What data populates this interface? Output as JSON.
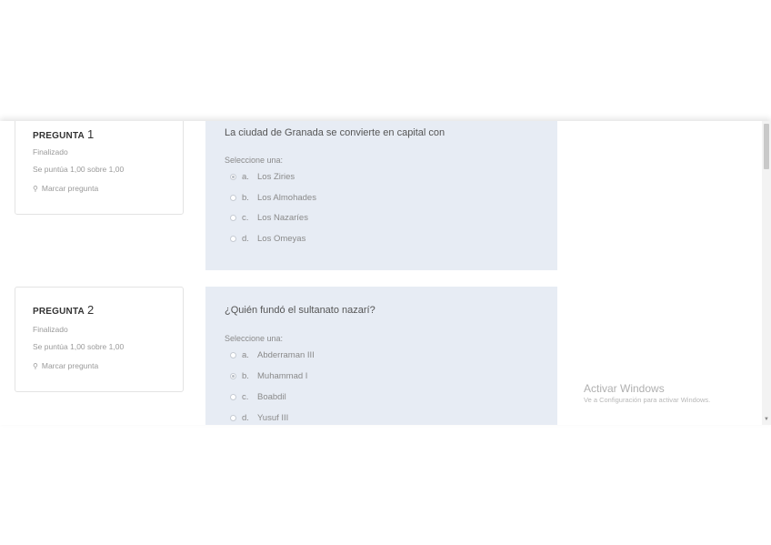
{
  "questions": [
    {
      "label": "PREGUNTA",
      "number": "1",
      "status": "Finalizado",
      "score": "Se puntúa 1,00 sobre 1,00",
      "flag_label": "Marcar pregunta",
      "text": "La ciudad de Granada se convierte en capital con",
      "select_prompt": "Seleccione una:",
      "options": [
        {
          "letter": "a.",
          "text": "Los Ziries",
          "checked": true
        },
        {
          "letter": "b.",
          "text": "Los Almohades",
          "checked": false
        },
        {
          "letter": "c.",
          "text": "Los Nazaríes",
          "checked": false
        },
        {
          "letter": "d.",
          "text": "Los Omeyas",
          "checked": false
        }
      ]
    },
    {
      "label": "PREGUNTA",
      "number": "2",
      "status": "Finalizado",
      "score": "Se puntúa 1,00 sobre 1,00",
      "flag_label": "Marcar pregunta",
      "text": "¿Quién fundó el sultanato nazarí?",
      "select_prompt": "Seleccione una:",
      "options": [
        {
          "letter": "a.",
          "text": "Abderraman III",
          "checked": false
        },
        {
          "letter": "b.",
          "text": "Muhammad I",
          "checked": true
        },
        {
          "letter": "c.",
          "text": "Boabdil",
          "checked": false
        },
        {
          "letter": "d.",
          "text": "Yusuf III",
          "checked": false
        }
      ]
    }
  ],
  "watermark": {
    "title": "Activar Windows",
    "subtitle": "Ve a Configuración para activar Windows."
  },
  "icons": {
    "flag": "flag-icon",
    "scroll_down": "scroll-down-arrow-icon"
  }
}
